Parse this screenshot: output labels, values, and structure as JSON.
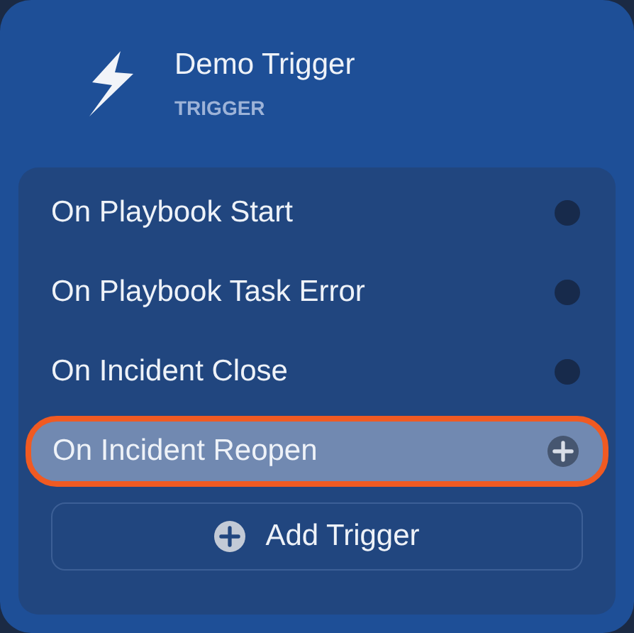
{
  "node": {
    "title": "Demo Trigger",
    "subtitle": "TRIGGER"
  },
  "triggers": [
    {
      "label": "On Playbook Start",
      "selected": false
    },
    {
      "label": "On Playbook Task Error",
      "selected": false
    },
    {
      "label": "On Incident Close",
      "selected": false
    },
    {
      "label": "On Incident Reopen",
      "selected": true
    }
  ],
  "add_button": {
    "label": "Add Trigger"
  }
}
